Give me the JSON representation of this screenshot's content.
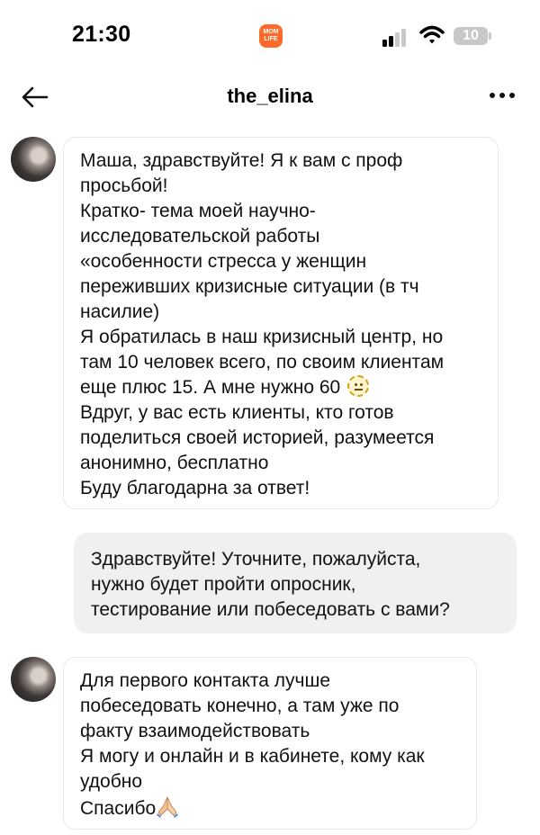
{
  "status_bar": {
    "time": "21:30",
    "app_logo_text": "MOM LIFE",
    "battery": "10",
    "icons": [
      "signal-icon",
      "wifi-icon",
      "battery-icon"
    ]
  },
  "header": {
    "title": "the_elina",
    "back_icon": "back-arrow-icon",
    "more_icon": "more-icon"
  },
  "messages": [
    {
      "direction": "incoming",
      "lines": [
        "Маша, здравствуйте! Я к вам с проф",
        "просьбой!",
        "Кратко- тема моей научно-",
        "исследовательской работы",
        "«особенности стресса у женщин",
        "переживших кризисные ситуации (в тч",
        "насилие)",
        "Я обратилась в наш кризисный центр, но",
        "там 10 человек всего, по своим клиентам",
        "еще плюс 15. А мне нужно 60",
        "Вдруг, у вас есть клиенты, кто готов",
        "поделиться своей историей, разумеется",
        "анонимно, бесплатно",
        "Буду благодарна за ответ!"
      ],
      "emoji": "neutral-face-icon"
    },
    {
      "direction": "outgoing",
      "lines": [
        "Здравствуйте! Уточните, пожалуйста,",
        "нужно будет пройти опросник,",
        "тестирование или побеседовать с вами?"
      ]
    },
    {
      "direction": "incoming",
      "lines": [
        "Для первого контакта лучше",
        "побеседовать конечно, а там уже по",
        "факту взаимодействовать",
        "Я могу и онлайн и в кабинете, кому как",
        "удобно",
        "Спасибо"
      ],
      "emoji": "folded-hands-icon"
    }
  ],
  "colors": {
    "incoming_bubble_bg": "#ffffff",
    "incoming_bubble_border": "#e8e8e8",
    "outgoing_bubble_bg": "#f0f0f0",
    "app_logo": "#ff6a2b",
    "battery": "#c8c8c8"
  }
}
